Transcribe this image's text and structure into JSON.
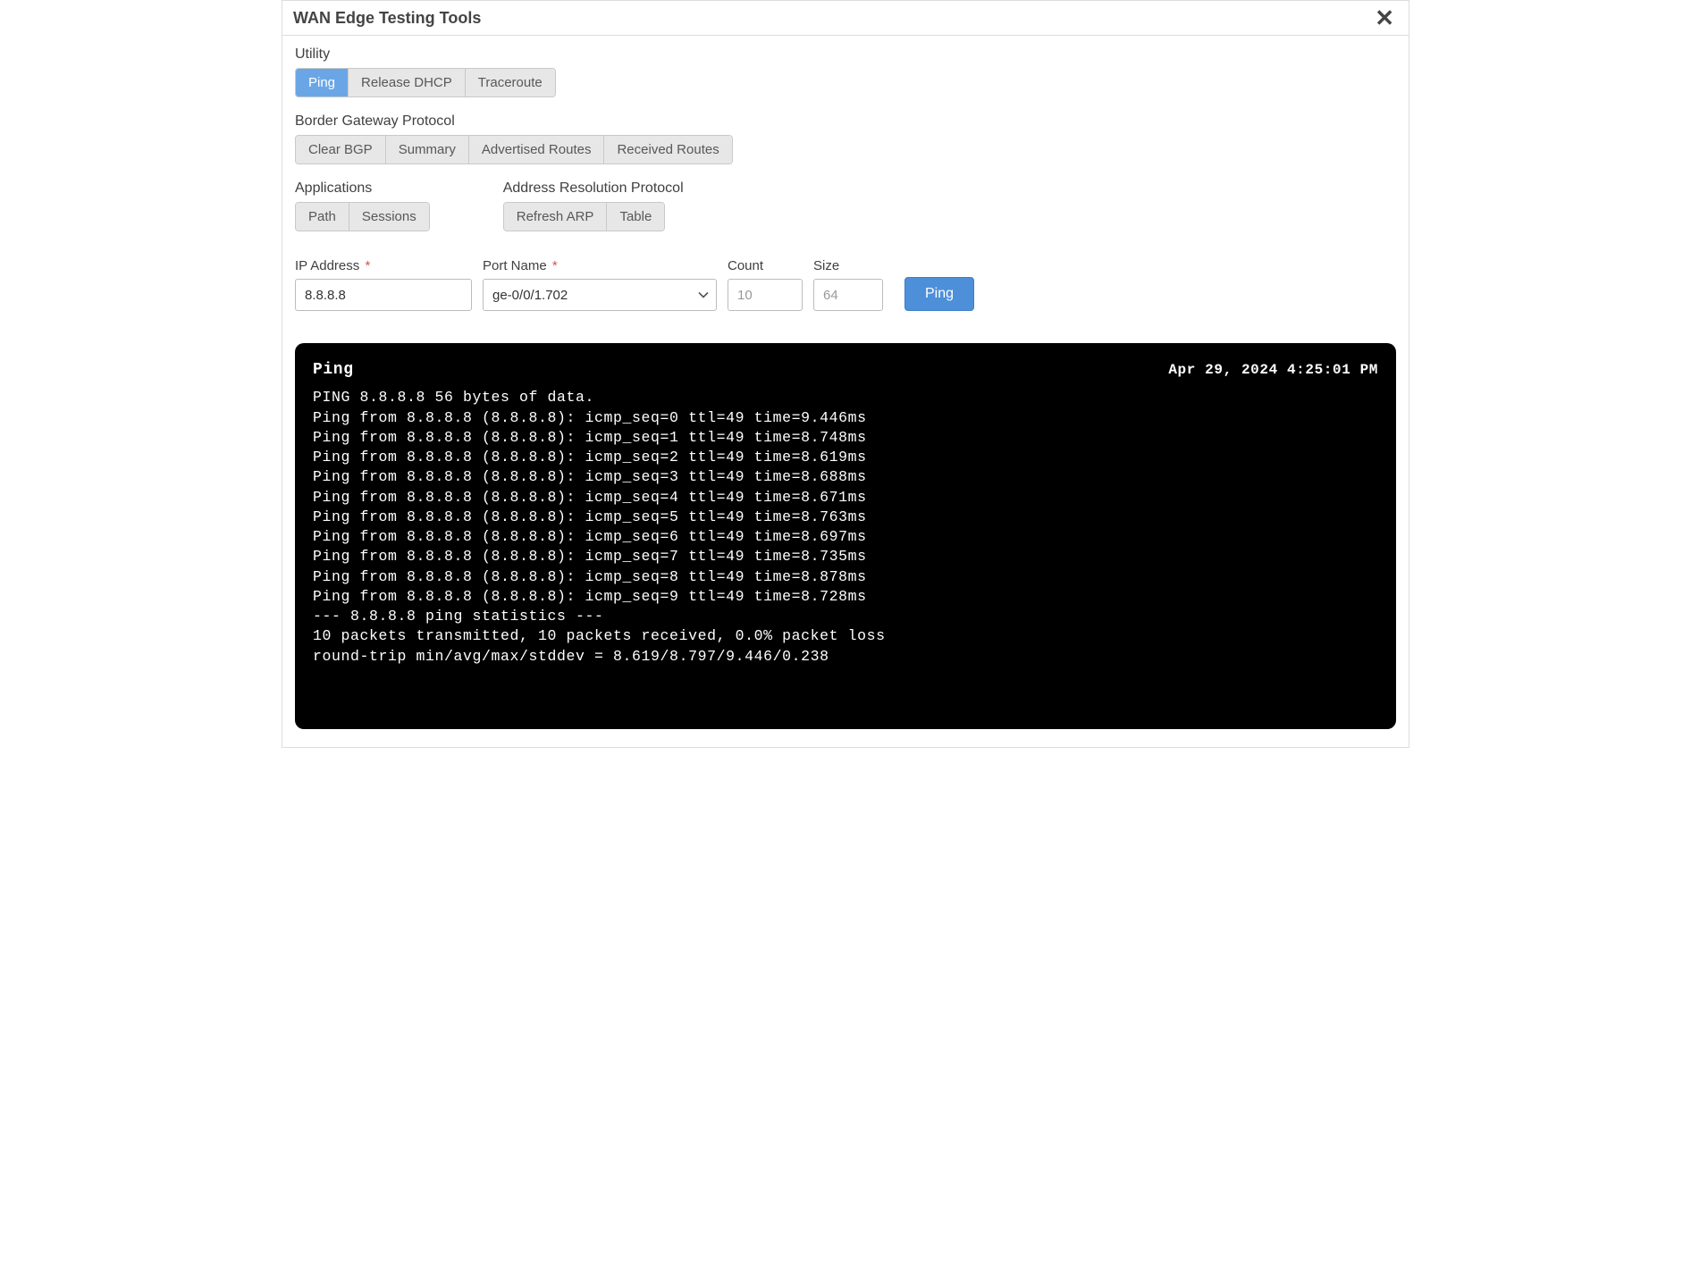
{
  "modal_title": "WAN Edge Testing Tools",
  "sections": {
    "utility": {
      "label": "Utility",
      "buttons": {
        "ping": "Ping",
        "release_dhcp": "Release DHCP",
        "traceroute": "Traceroute"
      }
    },
    "bgp": {
      "label": "Border Gateway Protocol",
      "buttons": {
        "clear_bgp": "Clear BGP",
        "summary": "Summary",
        "advertised": "Advertised Routes",
        "received": "Received Routes"
      }
    },
    "apps": {
      "label": "Applications",
      "buttons": {
        "path": "Path",
        "sessions": "Sessions"
      }
    },
    "arp": {
      "label": "Address Resolution Protocol",
      "buttons": {
        "refresh": "Refresh ARP",
        "table": "Table"
      }
    }
  },
  "form": {
    "ip_label": "IP Address",
    "ip_value": "8.8.8.8",
    "port_label": "Port Name",
    "port_value": "ge-0/0/1.702",
    "count_label": "Count",
    "count_placeholder": "10",
    "size_label": "Size",
    "size_placeholder": "64",
    "submit": "Ping"
  },
  "terminal": {
    "title": "Ping",
    "timestamp": "Apr 29, 2024 4:25:01 PM",
    "lines": [
      "PING 8.8.8.8 56 bytes of data.",
      "Ping from 8.8.8.8 (8.8.8.8): icmp_seq=0 ttl=49 time=9.446ms",
      "Ping from 8.8.8.8 (8.8.8.8): icmp_seq=1 ttl=49 time=8.748ms",
      "Ping from 8.8.8.8 (8.8.8.8): icmp_seq=2 ttl=49 time=8.619ms",
      "Ping from 8.8.8.8 (8.8.8.8): icmp_seq=3 ttl=49 time=8.688ms",
      "Ping from 8.8.8.8 (8.8.8.8): icmp_seq=4 ttl=49 time=8.671ms",
      "Ping from 8.8.8.8 (8.8.8.8): icmp_seq=5 ttl=49 time=8.763ms",
      "Ping from 8.8.8.8 (8.8.8.8): icmp_seq=6 ttl=49 time=8.697ms",
      "Ping from 8.8.8.8 (8.8.8.8): icmp_seq=7 ttl=49 time=8.735ms",
      "Ping from 8.8.8.8 (8.8.8.8): icmp_seq=8 ttl=49 time=8.878ms",
      "Ping from 8.8.8.8 (8.8.8.8): icmp_seq=9 ttl=49 time=8.728ms",
      "--- 8.8.8.8 ping statistics ---",
      "10 packets transmitted, 10 packets received, 0.0% packet loss",
      "round-trip min/avg/max/stddev = 8.619/8.797/9.446/0.238"
    ]
  }
}
